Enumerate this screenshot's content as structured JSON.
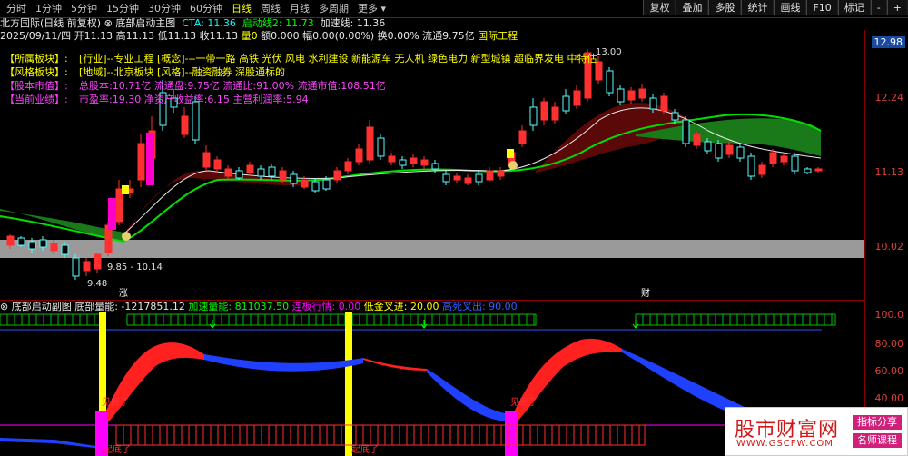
{
  "toolbar": {
    "periods": [
      "分时",
      "1分钟",
      "5分钟",
      "15分钟",
      "30分钟",
      "60分钟",
      "日线",
      "周线",
      "月线",
      "多周期",
      "更多"
    ],
    "active_period": "日线",
    "buttons": [
      "复权",
      "叠加",
      "多股",
      "统计",
      "画线",
      "F10",
      "标记",
      "-",
      "+"
    ]
  },
  "price_header": {
    "title": "北方国际(日线 前复权)",
    "indicator_name": "底部启动主图",
    "cta_label": "CTA: 11.36",
    "start_line_label": "启动线2: 11.73",
    "speed_line_label": "加速线: 11.36"
  },
  "ohlc": {
    "date": "2025/09/11/四",
    "open": "开11.13",
    "high": "高11.13",
    "low": "低11.13",
    "close": "收11.13",
    "volume": "量0",
    "amount": "额0.000",
    "change": "幅0.00(0.00%)",
    "turnover": "换0.00%",
    "float": "流通9.75亿",
    "tag": "国际工程"
  },
  "info_box": [
    {
      "key": "【所属板块】:",
      "value": "[行业]--专业工程 [概念]---一带一路 高铁 光伏 风电 水利建设 新能源车 无人机 绿色电力 新型城镇 超临界发电 中特估",
      "color": "#ffff00"
    },
    {
      "key": "【风格板块】:",
      "value": "[地域]--北京板块 [风格]--融资融券 深股通标的",
      "color": "#ffff00"
    },
    {
      "key": "【股本市值】:",
      "value": "总股本:10.71亿 流通盘:9.75亿 流通比:91.00% 流通市值:108.51亿",
      "color": "#ff44ff"
    },
    {
      "key": "【当前业绩】:",
      "value": "市盈率:19.30 净资产收益率:6.15 主营利润率:5.94",
      "color": "#ff44ff"
    }
  ],
  "price_axis": [
    "12.98",
    "12.24",
    "11.13",
    "10.02"
  ],
  "annotations": {
    "high_label": "13.00",
    "low_label": "9.48",
    "range_label": "9.85 - 10.14",
    "zhang_label": "涨",
    "cai_label": "财"
  },
  "sub_header": {
    "indicator": "底部启动副图",
    "bottom_energy": "底部量能: -1217851.12",
    "speed_energy": "加速量能: 811037.50",
    "limit_line": "连板行情: 0.00",
    "low_cross": "低金叉进: 20.00",
    "high_cross": "高死叉出: 90.00"
  },
  "sub_axis": [
    "100.0",
    "80.00",
    "60.00",
    "40.00"
  ],
  "sub_labels": {
    "bottomed": "见底了",
    "bottom_up": "起底了"
  },
  "watermark": {
    "title": "股市财富网",
    "url": "WWW.GSCFW.COM",
    "tag1": "指标分享",
    "tag2": "名师课程"
  },
  "colors": {
    "up": "#ff3030",
    "down": "#54ffff",
    "green_line": "#00e000",
    "accent": "#ffff00"
  }
}
